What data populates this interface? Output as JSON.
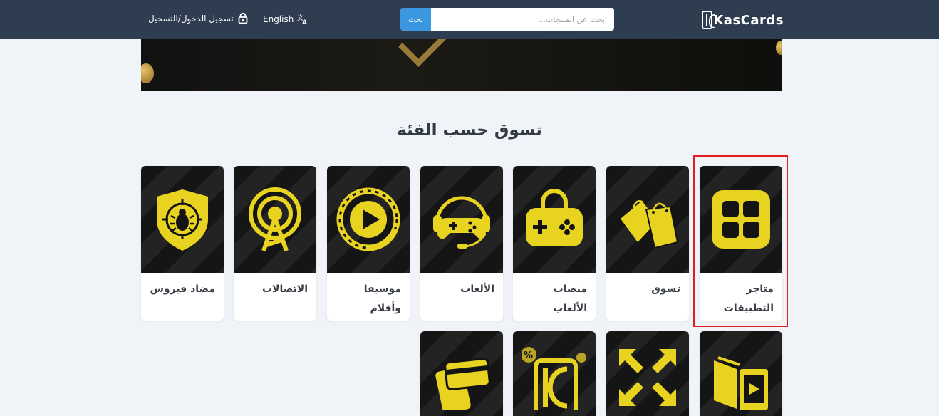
{
  "header": {
    "logo_text": "KasCards",
    "search": {
      "placeholder": "ابحث عن المنتجات...",
      "button_label": "بحث"
    },
    "language_label": "English",
    "login_label": "تسجيل الدخول/التسجيل"
  },
  "section": {
    "title": "تسوق حسب الفئة"
  },
  "categories": [
    {
      "label": "متاجر التطبيقات",
      "icon": "app-store-icon"
    },
    {
      "label": "تسوق",
      "icon": "shopping-bags-icon"
    },
    {
      "label": "منصات الألعاب",
      "icon": "game-console-icon"
    },
    {
      "label": "الألعاب",
      "icon": "gamepad-headset-icon"
    },
    {
      "label": "موسيقا وأفلام",
      "icon": "film-reel-play-icon"
    },
    {
      "label": "الاتصالات",
      "icon": "signal-tower-icon"
    },
    {
      "label": "مضاد فيروس",
      "icon": "antivirus-shield-icon"
    }
  ],
  "second_row_icons": [
    "ebook-icon",
    "expand-arrows-icon",
    "kascards-card-icon",
    "payment-card-icon"
  ],
  "colors": {
    "header_bg": "#2e3d4f",
    "accent": "#3a97e0",
    "icon_yellow": "#e8d321",
    "highlight": "#e02020"
  }
}
